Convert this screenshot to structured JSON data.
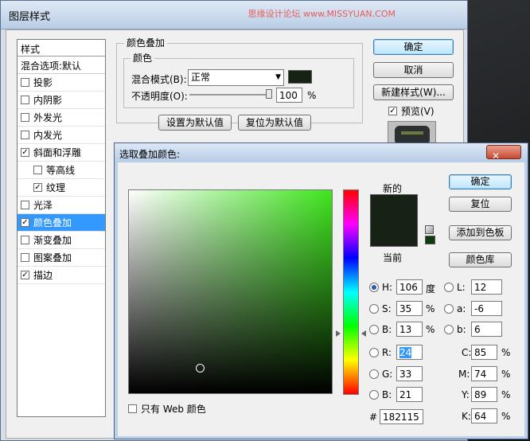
{
  "layer_style": {
    "title": "图层样式",
    "watermark": "思缘设计论坛 www.MISSYUAN.COM",
    "styles_header": "样式",
    "blend_options": "混合选项:默认",
    "items": [
      {
        "label": "投影",
        "checked": false,
        "indent": false,
        "selected": false
      },
      {
        "label": "内阴影",
        "checked": false,
        "indent": false,
        "selected": false
      },
      {
        "label": "外发光",
        "checked": false,
        "indent": false,
        "selected": false
      },
      {
        "label": "内发光",
        "checked": false,
        "indent": false,
        "selected": false
      },
      {
        "label": "斜面和浮雕",
        "checked": true,
        "indent": false,
        "selected": false
      },
      {
        "label": "等高线",
        "checked": false,
        "indent": true,
        "selected": false
      },
      {
        "label": "纹理",
        "checked": true,
        "indent": true,
        "selected": false
      },
      {
        "label": "光泽",
        "checked": false,
        "indent": false,
        "selected": false
      },
      {
        "label": "颜色叠加",
        "checked": true,
        "indent": false,
        "selected": true
      },
      {
        "label": "渐变叠加",
        "checked": false,
        "indent": false,
        "selected": false
      },
      {
        "label": "图案叠加",
        "checked": false,
        "indent": false,
        "selected": false
      },
      {
        "label": "描边",
        "checked": true,
        "indent": false,
        "selected": false
      }
    ],
    "section_title": "颜色叠加",
    "group_title": "颜色",
    "blend_mode_label": "混合模式(B):",
    "blend_mode_value": "正常",
    "opacity_label": "不透明度(O):",
    "opacity_value": "100",
    "opacity_unit": "%",
    "set_default": "设置为默认值",
    "reset_default": "复位为默认值",
    "ok": "确定",
    "cancel": "取消",
    "new_style": "新建样式(W)...",
    "preview": "预览(V)",
    "swatch_color": "#182115"
  },
  "picker": {
    "title": "选取叠加颜色:",
    "close_symbol": "✕",
    "new_label": "新的",
    "current_label": "当前",
    "new_color": "#182115",
    "current_color": "#182115",
    "gamut_color": "#0d3b0d",
    "hue_color": "#3fe51e",
    "ok": "确定",
    "reset": "复位",
    "add_swatch": "添加到色板",
    "color_lib": "颜色库",
    "web_only": "只有 Web 颜色",
    "h": {
      "label": "H:",
      "value": "106",
      "unit": "度"
    },
    "s": {
      "label": "S:",
      "value": "35",
      "unit": "%"
    },
    "bri": {
      "label": "B:",
      "value": "13",
      "unit": "%"
    },
    "r": {
      "label": "R:",
      "value": "24"
    },
    "g": {
      "label": "G:",
      "value": "33"
    },
    "b": {
      "label": "B:",
      "value": "21"
    },
    "l": {
      "label": "L:",
      "value": "12"
    },
    "a": {
      "label": "a:",
      "value": "-6"
    },
    "bb": {
      "label": "b:",
      "value": "6"
    },
    "c": {
      "label": "C:",
      "value": "85",
      "unit": "%"
    },
    "m": {
      "label": "M:",
      "value": "74",
      "unit": "%"
    },
    "y": {
      "label": "Y:",
      "value": "89",
      "unit": "%"
    },
    "k": {
      "label": "K:",
      "value": "64",
      "unit": "%"
    },
    "hex_label": "#",
    "hex_value": "182115"
  }
}
